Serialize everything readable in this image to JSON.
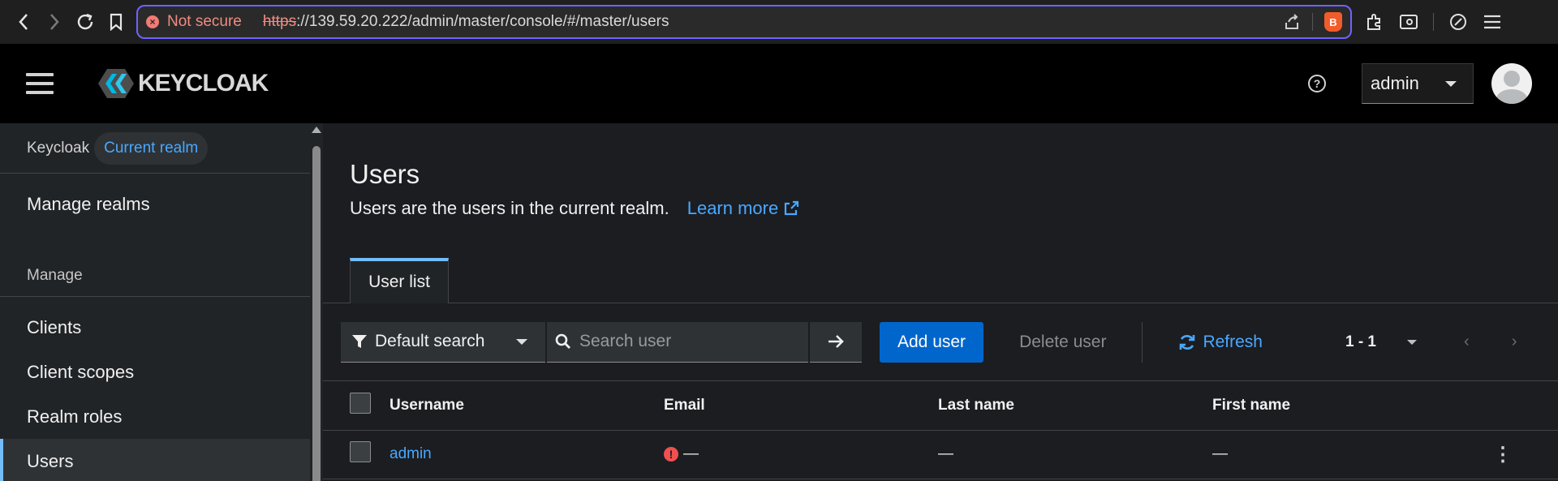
{
  "browser": {
    "security_label": "Not secure",
    "url_scheme": "https",
    "url_rest": "://139.59.20.222/admin/master/console/#/master/users",
    "brave_badge": "B"
  },
  "header": {
    "brand": "KEYCLOAK",
    "help_glyph": "?",
    "user_menu": "admin"
  },
  "sidebar": {
    "realm_label": "Keycloak",
    "realm_chip": "Current realm",
    "manage_realms": "Manage realms",
    "section_manage": "Manage",
    "items": [
      "Clients",
      "Client scopes",
      "Realm roles",
      "Users"
    ],
    "active_item": "Users"
  },
  "page": {
    "title": "Users",
    "description": "Users are the users in the current realm.",
    "learn_more": "Learn more",
    "tab_user_list": "User list"
  },
  "toolbar": {
    "filter_label": "Default search",
    "search_placeholder": "Search user",
    "add_user": "Add user",
    "delete_user": "Delete user",
    "refresh": "Refresh",
    "pagination": "1 - 1"
  },
  "table": {
    "columns": [
      "Username",
      "Email",
      "Last name",
      "First name"
    ],
    "rows": [
      {
        "username": "admin",
        "email": "—",
        "last_name": "—",
        "first_name": "—"
      }
    ]
  },
  "colors": {
    "accent_blue": "#4aa8ff",
    "primary_button": "#0066cc",
    "address_border": "#6d63ff",
    "error_red": "#f0504f"
  }
}
